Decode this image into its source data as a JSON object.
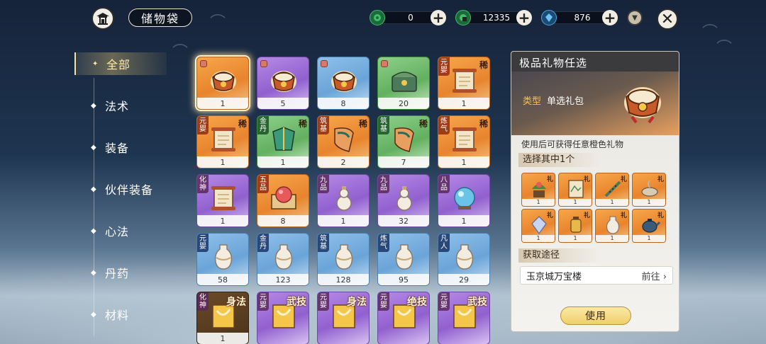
{
  "header": {
    "title": "储物袋",
    "currencies": [
      {
        "icon": "green-spirit-stone-icon",
        "value": "0",
        "color": "#3fbf6a"
      },
      {
        "icon": "locked-spirit-stone-icon",
        "value": "12335",
        "color": "#3fbf6a"
      },
      {
        "icon": "blue-crystal-icon",
        "value": "876",
        "color": "#4aa8e8"
      }
    ]
  },
  "sidebar": {
    "items": [
      {
        "label": "全部",
        "active": true
      },
      {
        "label": "法术",
        "active": false
      },
      {
        "label": "装备",
        "active": false
      },
      {
        "label": "伙伴装备",
        "active": false
      },
      {
        "label": "心法",
        "active": false
      },
      {
        "label": "丹药",
        "active": false
      },
      {
        "label": "材料",
        "active": false
      }
    ]
  },
  "grid": {
    "rows": [
      [
        {
          "color": "orange",
          "grade": "",
          "tag": "",
          "count": "1",
          "icon": "gift-pack-icon",
          "selected": true
        },
        {
          "color": "purple",
          "grade": "",
          "tag": "",
          "count": "5",
          "icon": "gift-pack-icon"
        },
        {
          "color": "blue",
          "grade": "",
          "tag": "",
          "count": "8",
          "icon": "gift-pack-icon"
        },
        {
          "color": "green",
          "grade": "",
          "tag": "",
          "count": "20",
          "icon": "treasure-chest-icon"
        },
        {
          "color": "orange",
          "grade": "元婴",
          "tag": "稀",
          "count": "1",
          "icon": "scroll-icon"
        }
      ],
      [
        {
          "color": "orange",
          "grade": "元婴",
          "tag": "稀",
          "count": "1",
          "icon": "scroll-icon"
        },
        {
          "color": "green",
          "grade": "金丹",
          "tag": "稀",
          "count": "1",
          "icon": "armor-icon"
        },
        {
          "color": "orange",
          "grade": "筑基",
          "tag": "稀",
          "count": "2",
          "icon": "banner-icon"
        },
        {
          "color": "green",
          "grade": "筑基",
          "tag": "稀",
          "count": "7",
          "icon": "banner-icon"
        },
        {
          "color": "orange",
          "grade": "炼气",
          "tag": "稀",
          "count": "1",
          "icon": "scroll-icon"
        }
      ],
      [
        {
          "color": "purple",
          "grade": "化神",
          "tag": "",
          "count": "1",
          "icon": "scroll-icon"
        },
        {
          "color": "orange",
          "grade": "五品",
          "tag": "",
          "count": "8",
          "icon": "pearl-box-icon"
        },
        {
          "color": "purple",
          "grade": "九品",
          "tag": "",
          "count": "1",
          "icon": "gourd-icon"
        },
        {
          "color": "purple",
          "grade": "九品",
          "tag": "",
          "count": "32",
          "icon": "gourd-icon"
        },
        {
          "color": "purple",
          "grade": "八品",
          "tag": "",
          "count": "1",
          "icon": "crystal-orb-icon"
        }
      ],
      [
        {
          "color": "blue",
          "grade": "元婴",
          "tag": "",
          "count": "58",
          "icon": "vase-icon"
        },
        {
          "color": "blue",
          "grade": "金丹",
          "tag": "",
          "count": "123",
          "icon": "vase-icon"
        },
        {
          "color": "blue",
          "grade": "筑基",
          "tag": "",
          "count": "128",
          "icon": "vase-icon"
        },
        {
          "color": "blue",
          "grade": "炼气",
          "tag": "",
          "count": "95",
          "icon": "vase-icon"
        },
        {
          "color": "blue",
          "grade": "凡人",
          "tag": "",
          "count": "29",
          "icon": "vase-icon"
        }
      ],
      [
        {
          "color": "brown",
          "grade": "化神",
          "tag": "身法",
          "count": "1",
          "icon": "manual-icon"
        },
        {
          "color": "purple",
          "grade": "元婴",
          "tag": "武技",
          "count": "",
          "icon": "manual-icon"
        },
        {
          "color": "purple",
          "grade": "元婴",
          "tag": "身法",
          "count": "",
          "icon": "manual-icon"
        },
        {
          "color": "purple",
          "grade": "元婴",
          "tag": "绝技",
          "count": "",
          "icon": "manual-icon"
        },
        {
          "color": "purple",
          "grade": "元婴",
          "tag": "武技",
          "count": "",
          "icon": "manual-icon"
        }
      ]
    ]
  },
  "detail": {
    "title": "极品礼物任选",
    "type_key": "类型",
    "type_value": "单选礼包",
    "description": "使用后可获得任意橙色礼物",
    "choose_label": "选择其中1个",
    "rewards": [
      {
        "tag": "礼",
        "count": "1",
        "icon": "flower-pot-icon"
      },
      {
        "tag": "礼",
        "count": "1",
        "icon": "painting-icon"
      },
      {
        "tag": "礼",
        "count": "1",
        "icon": "flute-icon"
      },
      {
        "tag": "礼",
        "count": "1",
        "icon": "incense-bowl-icon"
      },
      {
        "tag": "礼",
        "count": "1",
        "icon": "gem-icon"
      },
      {
        "tag": "礼",
        "count": "1",
        "icon": "lantern-icon"
      },
      {
        "tag": "礼",
        "count": "1",
        "icon": "vase-icon"
      },
      {
        "tag": "礼",
        "count": "1",
        "icon": "teapot-icon"
      }
    ],
    "source_label": "获取途径",
    "source_name": "玉京城万宝楼",
    "source_go": "前往",
    "use_label": "使用"
  }
}
